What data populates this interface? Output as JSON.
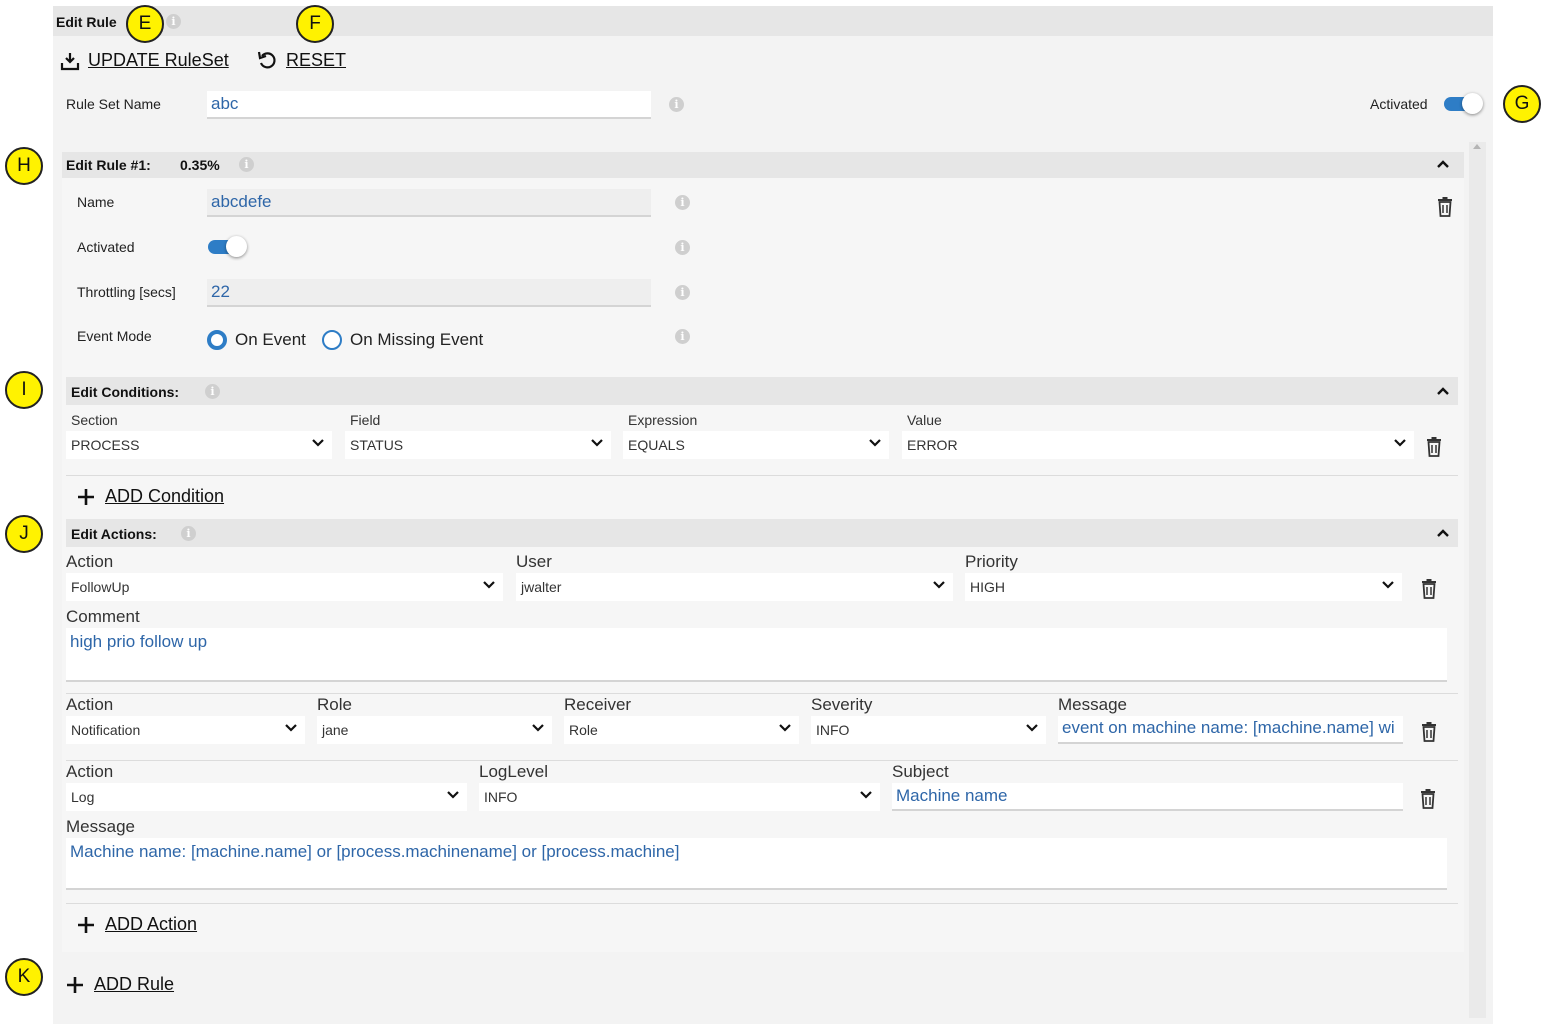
{
  "panel": {
    "title": "Edit Rule"
  },
  "toolbar": {
    "update_label": "UPDATE RuleSet",
    "reset_label": "RESET"
  },
  "ruleset": {
    "name_label": "Rule Set Name",
    "name_value": "abc",
    "activated_label": "Activated",
    "activated": true
  },
  "rule": {
    "title": "Edit Rule #1:",
    "percent": "0.35%",
    "name_label": "Name",
    "name_value": "abcdefe",
    "activated_label": "Activated",
    "activated": true,
    "throttling_label": "Throttling [secs]",
    "throttling_value": "22",
    "event_mode_label": "Event Mode",
    "event_mode_options": [
      "On Event",
      "On Missing Event"
    ],
    "event_mode_selected": "On Event"
  },
  "conditions": {
    "title": "Edit Conditions:",
    "headers": [
      "Section",
      "Field",
      "Expression",
      "Value"
    ],
    "rows": [
      {
        "section": "PROCESS",
        "field": "STATUS",
        "expression": "EQUALS",
        "value": "ERROR"
      }
    ],
    "add_label": "ADD Condition"
  },
  "actions": {
    "title": "Edit Actions:",
    "followup": {
      "action_label": "Action",
      "action_value": "FollowUp",
      "user_label": "User",
      "user_value": "jwalter",
      "priority_label": "Priority",
      "priority_value": "HIGH",
      "comment_label": "Comment",
      "comment_value": "high prio follow up"
    },
    "notification": {
      "action_label": "Action",
      "action_value": "Notification",
      "role_label": "Role",
      "role_value": "jane",
      "receiver_label": "Receiver",
      "receiver_value": "Role",
      "severity_label": "Severity",
      "severity_value": "INFO",
      "message_label": "Message",
      "message_value": "event on machine name: [machine.name] wi"
    },
    "log": {
      "action_label": "Action",
      "action_value": "Log",
      "loglevel_label": "LogLevel",
      "loglevel_value": "INFO",
      "subject_label": "Subject",
      "subject_value": "Machine name",
      "message_label": "Message",
      "message_value": "Machine name: [machine.name] or [process.machinename] or [process.machine]"
    },
    "add_label": "ADD Action"
  },
  "add_rule_label": "ADD Rule",
  "badges": [
    "E",
    "F",
    "G",
    "H",
    "I",
    "J",
    "K"
  ],
  "colors": {
    "accent": "#2e7dc6",
    "input_text": "#2e66a8",
    "badge": "#fff200"
  }
}
